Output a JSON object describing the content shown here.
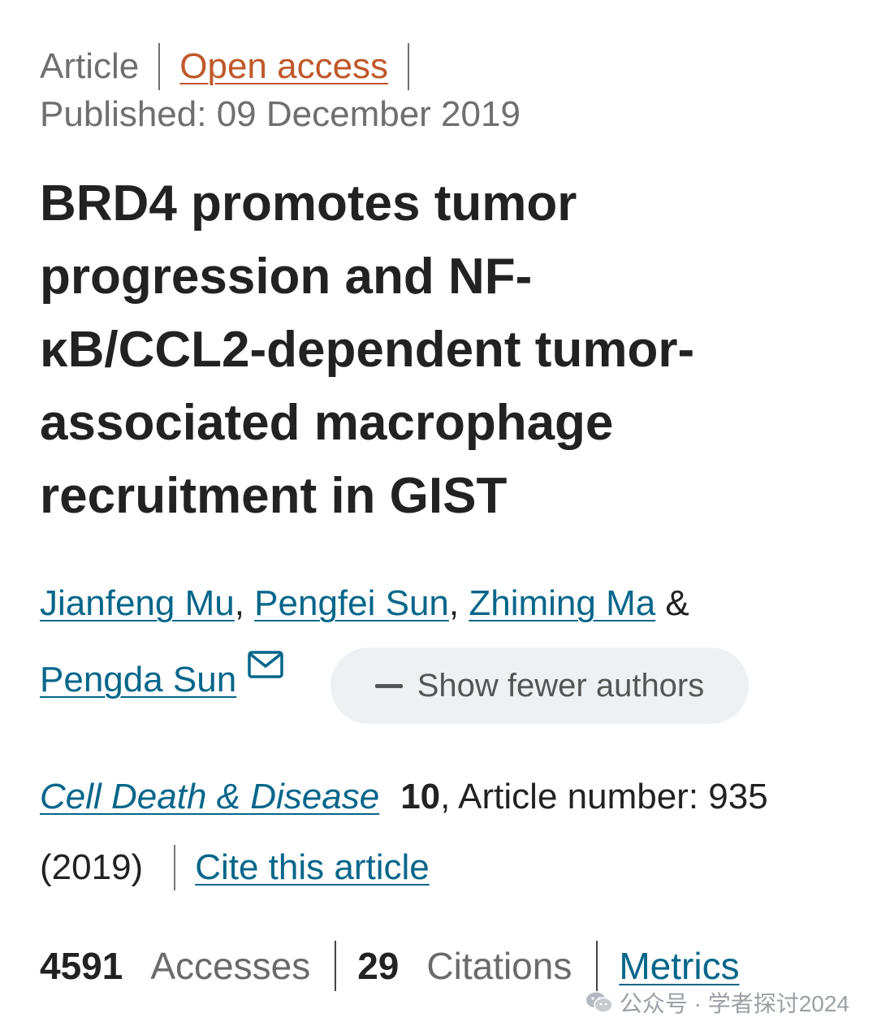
{
  "meta": {
    "type": "Article",
    "open_access": "Open access",
    "published": "Published: 09 December 2019"
  },
  "title_lines": [
    "BRD4 promotes tumor",
    "progression and NF-",
    "κB/CCL2-dependent tumor-",
    "associated macrophage",
    "recruitment in GIST"
  ],
  "authors": [
    {
      "name": "Jianfeng Mu",
      "sep": ", "
    },
    {
      "name": "Pengfei Sun",
      "sep": ", "
    },
    {
      "name": "Zhiming Ma",
      "sep": " &"
    },
    {
      "name": "Pengda Sun"
    }
  ],
  "show_fewer": "Show fewer authors",
  "citation": {
    "journal": "Cell Death & Disease",
    "volume": "10",
    "article_number": ", Article number: 935",
    "year": "(2019)",
    "cite_link": "Cite this article"
  },
  "stats": {
    "accesses_value": "4591",
    "accesses_label": "Accesses",
    "citations_value": "29",
    "citations_label": "Citations",
    "metrics_link": "Metrics"
  },
  "watermark": "公众号 · 学者探讨2024",
  "colors": {
    "link": "#05668a",
    "open_access": "#c0582a",
    "muted": "#6f6f6f"
  }
}
